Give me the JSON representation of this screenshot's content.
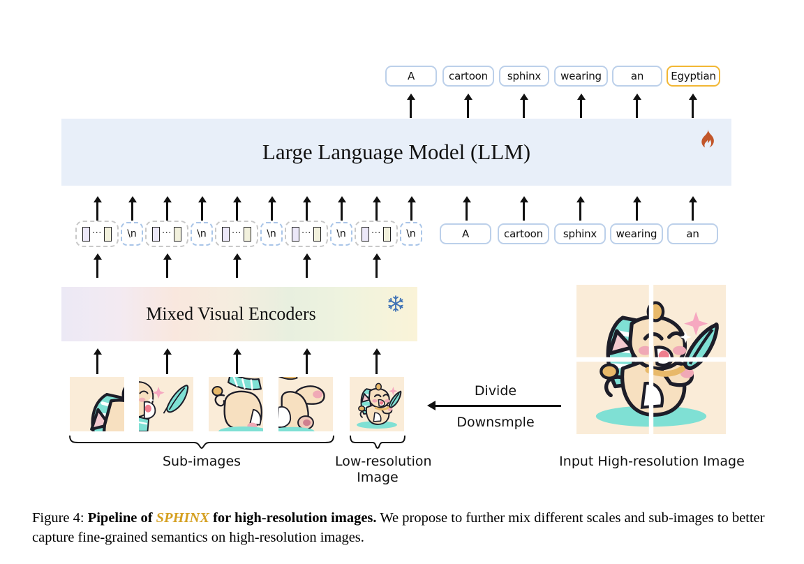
{
  "figure": {
    "caption_prefix": "Figure 4:",
    "caption_bold_1": "Pipeline of",
    "caption_brand": "SPHINX",
    "caption_bold_2": "for high-resolution images.",
    "caption_rest": "We propose to further mix different scales and sub-images to better capture fine-grained semantics on high-resolution images."
  },
  "output_tokens": [
    {
      "text": "A",
      "highlighted": false
    },
    {
      "text": "cartoon",
      "highlighted": false
    },
    {
      "text": "sphinx",
      "highlighted": false
    },
    {
      "text": "wearing",
      "highlighted": false
    },
    {
      "text": "an",
      "highlighted": false
    },
    {
      "text": "Egyptian",
      "highlighted": true
    }
  ],
  "llm": {
    "title": "Large Language Model (LLM)",
    "state_icon": "flame-icon",
    "state": "trainable",
    "panel_color": "#e8eff9",
    "icon_color": "#c2562a"
  },
  "encoder": {
    "title": "Mixed Visual Encoders",
    "state_icon": "snowflake-icon",
    "state": "frozen",
    "icon_color": "#3f72b5"
  },
  "visual_tokens": {
    "group_count": 5,
    "separator_label": "\\n",
    "patch_ellipsis": "···"
  },
  "input_text_tokens": [
    {
      "text": "A"
    },
    {
      "text": "cartoon"
    },
    {
      "text": "sphinx"
    },
    {
      "text": "wearing"
    },
    {
      "text": "an"
    }
  ],
  "labels": {
    "sub_images": "Sub-images",
    "low_resolution_line1": "Low-resolution",
    "low_resolution_line2": "Image",
    "input_image": "Input High-resolution Image",
    "divide": "Divide",
    "downsample": "Downsmple"
  },
  "image_subject": "cartoon sphinx cat wearing an Egyptian headdress with a feather"
}
